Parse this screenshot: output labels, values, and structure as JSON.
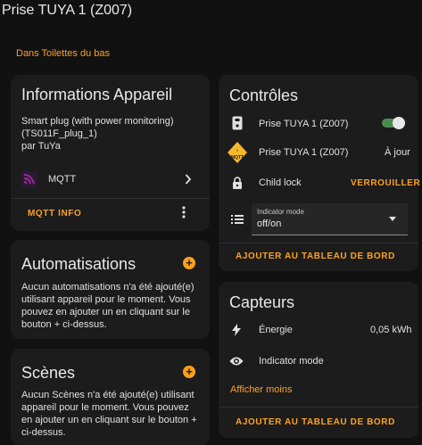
{
  "header": {
    "title": "Prise TUYA 1 (Z007)"
  },
  "area": "Dans Toilettes du bas",
  "device_info": {
    "title": "Informations Appareil",
    "model": "Smart plug (with power monitoring)",
    "model_id": "(TS011F_plug_1)",
    "manufacturer": "par TuYa",
    "integration": "MQTT",
    "mqtt_info_label": "MQTT INFO"
  },
  "automations": {
    "title": "Automatisations",
    "text": "Aucun automatisations n'a été ajouté(e) utilisant appareil pour le moment. Vous pouvez en ajouter un en cliquant sur le bouton + ci-dessus."
  },
  "scenes": {
    "title": "Scènes",
    "text": "Aucun Scènes n'a été ajouté(e) utilisant appareil pour le moment. Vous pouvez en ajouter un en cliquant sur le bouton + ci-dessus."
  },
  "controls": {
    "title": "Contrôles",
    "rows": [
      {
        "label": "Prise TUYA 1 (Z007)",
        "value": "",
        "icon": "power-socket-icon"
      },
      {
        "label": "Prise TUYA 1 (Z007)",
        "value": "À jour",
        "icon": "mqtt-update-icon"
      },
      {
        "label": "Child lock",
        "value": "VERROUILLER",
        "icon": "lock-icon"
      }
    ],
    "indicator_mode": {
      "label": "Indicator mode",
      "value": "off/on"
    },
    "add_to_dashboard": "AJOUTER AU TABLEAU DE BORD",
    "switch_on": true
  },
  "sensors": {
    "title": "Capteurs",
    "rows": [
      {
        "label": "Énergie",
        "value": "0,05 kWh",
        "icon": "flash-icon"
      },
      {
        "label": "Indicator mode",
        "value": "",
        "icon": "eye-icon"
      }
    ],
    "show_less": "Afficher moins",
    "add_to_dashboard": "AJOUTER AU TABLEAU DE BORD"
  },
  "colors": {
    "accent": "#fca222",
    "card": "#1c1c1c",
    "background": "#111111",
    "switch_track": "#4b8b50"
  }
}
